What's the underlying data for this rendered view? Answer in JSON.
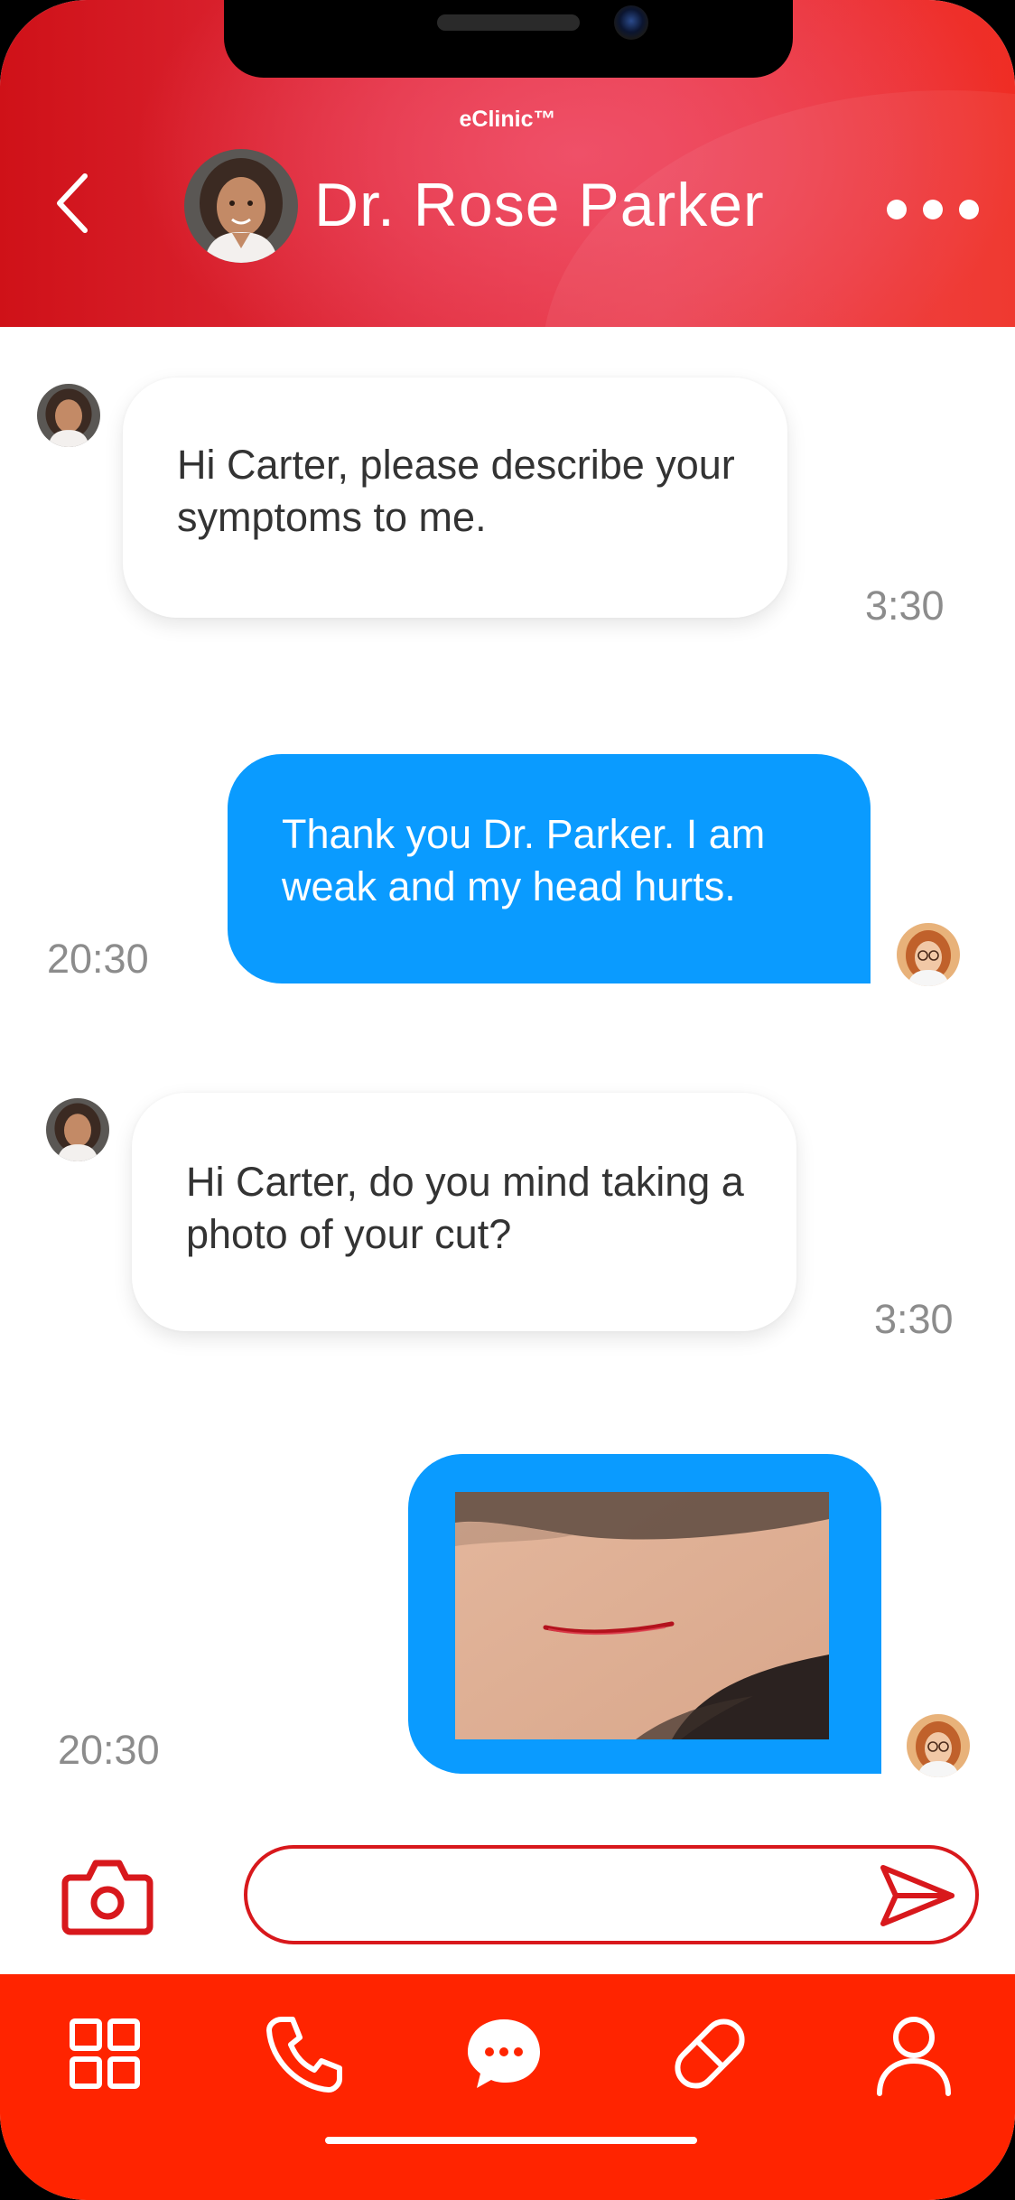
{
  "header": {
    "app_name": "eClinic™",
    "doctor_name": "Dr. Rose Parker"
  },
  "messages": [
    {
      "direction": "incoming",
      "text": "Hi Carter, please describe your symptoms to me.",
      "time": "3:30"
    },
    {
      "direction": "outgoing",
      "text": "Thank you Dr. Parker. I am weak and my head hurts.",
      "time": "20:30"
    },
    {
      "direction": "incoming",
      "text": "Hi Carter, do you mind taking a photo of your cut?",
      "time": "3:30"
    },
    {
      "direction": "outgoing",
      "type": "photo",
      "time": "20:30"
    }
  ],
  "composer": {
    "placeholder": "",
    "value": ""
  },
  "tabs": [
    {
      "icon": "grid-icon"
    },
    {
      "icon": "phone-icon"
    },
    {
      "icon": "chat-icon",
      "active": true
    },
    {
      "icon": "pill-icon"
    },
    {
      "icon": "user-icon"
    }
  ],
  "colors": {
    "brand_red": "#ff2400",
    "header_red": "#e02c3c",
    "outgoing_bubble": "#0a9bff",
    "timestamp": "#8c8c8c"
  }
}
